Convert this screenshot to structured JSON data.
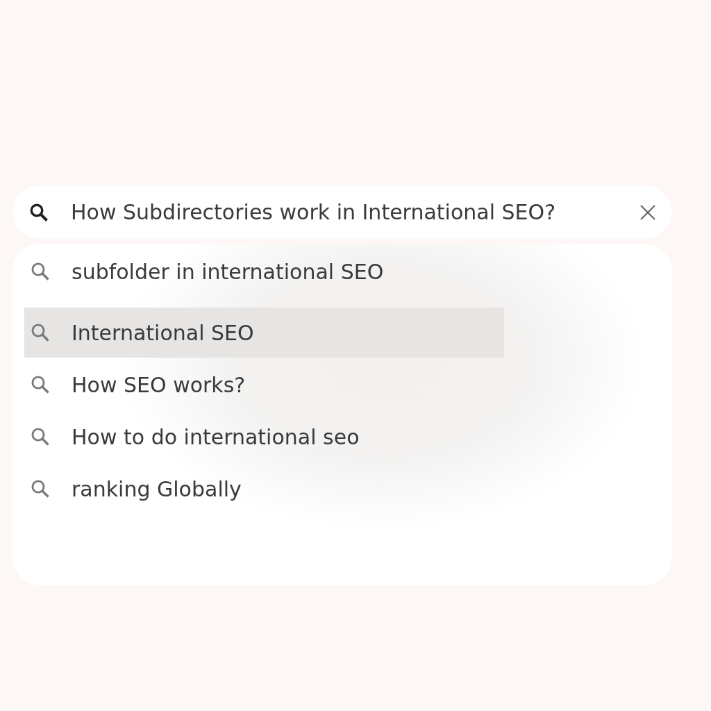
{
  "search": {
    "value": "How Subdirectories work in International SEO?"
  },
  "suggestions": [
    {
      "text": "subfolder in international SEO",
      "selected": false
    },
    {
      "text": "International SEO",
      "selected": true
    },
    {
      "text": "How SEO works?",
      "selected": false
    },
    {
      "text": "How to do international seo",
      "selected": false
    },
    {
      "text": "ranking Globally",
      "selected": false
    }
  ]
}
